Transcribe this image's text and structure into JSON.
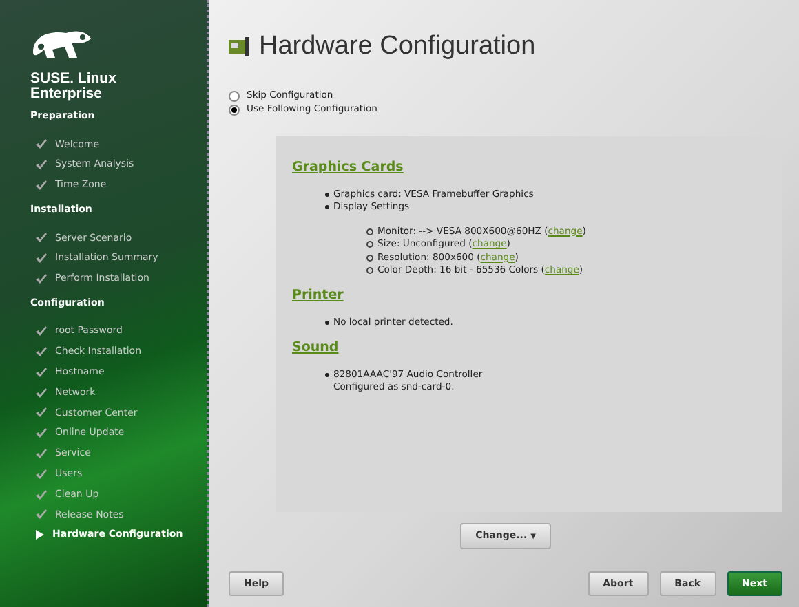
{
  "sidebar": {
    "brand": [
      "SUSE. Linux",
      "Enterprise"
    ],
    "sections": [
      {
        "title": "Preparation",
        "items": [
          {
            "label": "Welcome",
            "current": false
          },
          {
            "label": "System Analysis",
            "current": false
          },
          {
            "label": "Time Zone",
            "current": false
          }
        ]
      },
      {
        "title": "Installation",
        "items": [
          {
            "label": "Server Scenario",
            "current": false
          },
          {
            "label": "Installation Summary",
            "current": false
          },
          {
            "label": "Perform Installation",
            "current": false
          }
        ]
      },
      {
        "title": "Configuration",
        "items": [
          {
            "label": "root Password",
            "current": false
          },
          {
            "label": "Check Installation",
            "current": false
          },
          {
            "label": "Hostname",
            "current": false
          },
          {
            "label": "Network",
            "current": false
          },
          {
            "label": "Customer Center",
            "current": false
          },
          {
            "label": "Online Update",
            "current": false
          },
          {
            "label": "Service",
            "current": false
          },
          {
            "label": "Users",
            "current": false
          },
          {
            "label": "Clean Up",
            "current": false
          },
          {
            "label": "Release Notes",
            "current": false
          },
          {
            "label": "Hardware Configuration",
            "current": true
          }
        ]
      }
    ]
  },
  "title": "Hardware Configuration",
  "options": [
    {
      "label": "Skip Configuration",
      "selected": false
    },
    {
      "label": "Use Following Configuration",
      "selected": true
    }
  ],
  "summary": [
    {
      "heading": "Graphics Cards",
      "items": [
        {
          "text": "Graphics card: VESA Framebuffer Graphics"
        },
        {
          "text": "Display Settings",
          "children": [
            {
              "text": "Monitor: --> VESA 800X600@60HZ (",
              "link": "change",
              "after": ")"
            },
            {
              "text": "Size: Unconfigured (",
              "link": "change",
              "after": ")"
            },
            {
              "text": "Resolution: 800x600 (",
              "link": "change",
              "after": ")"
            },
            {
              "text": "Color Depth: 16 bit - 65536 Colors (",
              "link": "change",
              "after": ")"
            }
          ]
        }
      ]
    },
    {
      "heading": "Printer",
      "items": [
        {
          "text": "No local printer detected."
        }
      ]
    },
    {
      "heading": "Sound",
      "items": [
        {
          "text": "82801AAAC'97 Audio Controller",
          "note": "Configured as snd-card-0."
        }
      ]
    }
  ],
  "change_button": {
    "label": "Change...",
    "caret": "▼"
  },
  "buttons": [
    {
      "label": "Help",
      "kind": "left"
    },
    {
      "label": "Abort",
      "kind": "normal"
    },
    {
      "label": "Back",
      "kind": "normal"
    },
    {
      "label": "Next",
      "kind": "primary"
    }
  ]
}
